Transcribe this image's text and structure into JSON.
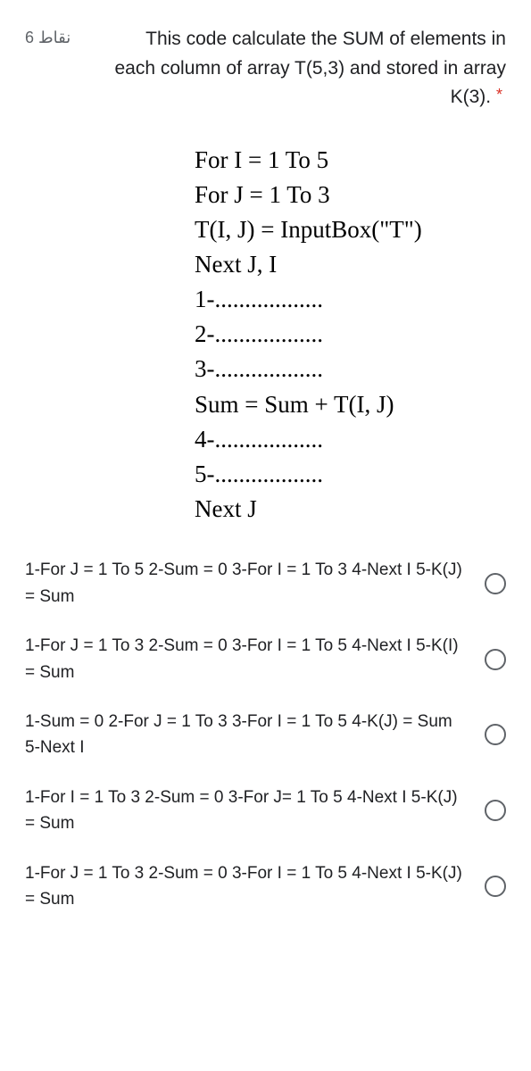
{
  "header": {
    "points": "6 نقاط",
    "question": "This code calculate the SUM of elements in each column of array T(5,3) and stored in array K(3).",
    "asterisk": "*"
  },
  "code": {
    "lines": [
      "For I = 1 To 5",
      "For J = 1 To 3",
      "T(I, J) = InputBox(\"T\")",
      "Next J, I",
      "1-..................",
      "2-..................",
      "3-..................",
      "Sum = Sum + T(I, J)",
      "4-..................",
      "5-..................",
      "Next J"
    ]
  },
  "options": [
    {
      "text": "1-For J = 1 To 5 2-Sum = 0 3-For I = 1 To 3 4-Next I 5-K(J) = Sum"
    },
    {
      "text": "1-For J = 1 To 3 2-Sum = 0 3-For I = 1 To 5 4-Next I 5-K(I) = Sum"
    },
    {
      "text": "1-Sum = 0 2-For J = 1 To 3 3-For I = 1 To 5 4-K(J) = Sum 5-Next I"
    },
    {
      "text": "1-For I = 1 To 3 2-Sum = 0 3-For J= 1 To 5 4-Next I 5-K(J) = Sum"
    },
    {
      "text": "1-For J = 1 To 3 2-Sum = 0 3-For I = 1 To 5 4-Next I 5-K(J) = Sum"
    }
  ]
}
